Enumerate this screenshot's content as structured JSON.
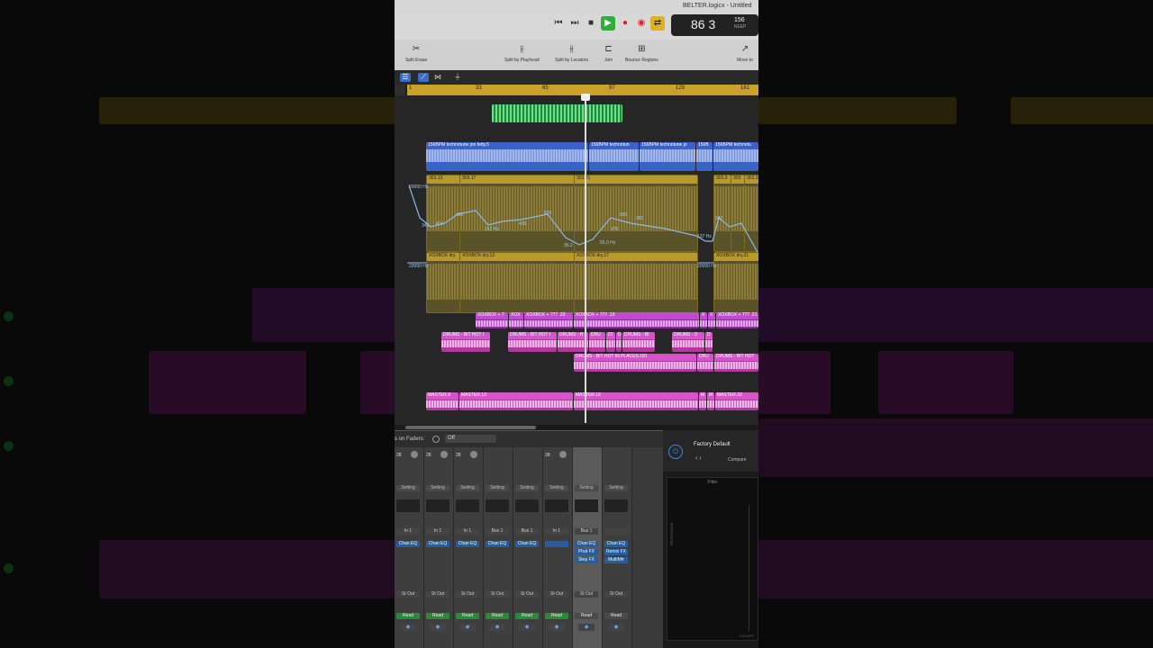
{
  "window": {
    "title": "BELTER.logicx - Untitled"
  },
  "transport": {
    "rewind": "⏮",
    "forward": "⏭",
    "stop": "■",
    "play": "▶",
    "record": "●",
    "capture": "◉",
    "cycle": "⇄",
    "position": "86 3",
    "tempo": "156",
    "tempo_sub": "KEEP"
  },
  "tools": [
    {
      "label": "Split Erase",
      "icon": "scissors-icon"
    },
    {
      "label": "Split by Playhead",
      "icon": "split-icon"
    },
    {
      "label": "Split by Locators",
      "icon": "split-locators-icon"
    },
    {
      "label": "Join",
      "icon": "join-icon"
    },
    {
      "label": "Bounce Regions",
      "icon": "bounce-icon"
    },
    {
      "label": "Move to",
      "icon": "move-icon"
    }
  ],
  "ruler": [
    "1",
    "33",
    "65",
    "97",
    "129",
    "161"
  ],
  "regions": {
    "blue": [
      "156BPM technotune jon fetty.5",
      "156BPM technotun",
      "156BPM technotune jo",
      "156B",
      "156BPM technotu"
    ],
    "yellow1": [
      "303.13",
      "303.17",
      "303.21",
      "303.9",
      "303",
      "303.3"
    ],
    "yellow2": [
      "XOXBOX dry",
      "XOXBOX dry.13",
      "XOXBOX dry.17",
      "XOXBOX dry.21"
    ],
    "purple": [
      "XOXBOX + 7",
      "XOX",
      "XOXBOX + 777 .20",
      "XOXBOX + 777 .19",
      "X",
      "X",
      "XOXBOX + 777 .21"
    ],
    "drums1": [
      "DRUMS - BIT HOT I",
      "DRUMS - BIT HOT I",
      "DRUMS - H",
      "DRU",
      "DI",
      "D",
      "DRUMS - BI",
      "DRUMS - D",
      "D"
    ],
    "drums2": [
      "DRUMS - BIT HOT IN PLACES.181",
      "DRU",
      "DRUMS - BIT HOT"
    ],
    "master": [
      "MASTER.9",
      "MASTER.13",
      "MASTER.19",
      "M",
      "M",
      "MASTER.22"
    ]
  },
  "automation": {
    "top": "20000 Hz",
    "vals": [
      "342",
      "414",
      "482",
      "262 Hz",
      "436",
      "825",
      "600",
      "382",
      "276",
      "36.2",
      "55.0 Hz",
      "342",
      "137 Hz",
      "151",
      "127"
    ],
    "mid_left": "20000 Hz",
    "mid_right": "20000 Hz"
  },
  "mixer": {
    "header_label": "s on Faders:",
    "header_value": "Off",
    "gains": [
      "28",
      "28",
      "28",
      "",
      "",
      "28",
      "",
      ""
    ],
    "setting": "Setting",
    "inputs": [
      "In 1",
      "In 1",
      "In 1",
      "Bus 1",
      "Bus 1",
      "In 1",
      "Bus 1",
      ""
    ],
    "plugins": [
      [
        "Chan EQ"
      ],
      [
        "Chan EQ"
      ],
      [
        "Chan EQ"
      ],
      [
        "Chan EQ"
      ],
      [
        "Chan EQ"
      ],
      [
        ""
      ],
      [
        "Chan EQ",
        "Phat FX",
        "Step FX"
      ],
      [
        "Chan EQ",
        "Remix FX",
        "MultiMtr"
      ]
    ],
    "output": "St Out",
    "read": "Read"
  },
  "plugin": {
    "preset": "Factory Default",
    "compare": "Compare",
    "graph_title": "Filter",
    "y_label": "RESONANCE",
    "x_label": "CUTOFF",
    "power": "⏻",
    "nav": "‹  ›"
  },
  "colors": {
    "accent": "#3a6cc8",
    "play": "#2fae3a",
    "ruler": "#caa22a"
  }
}
